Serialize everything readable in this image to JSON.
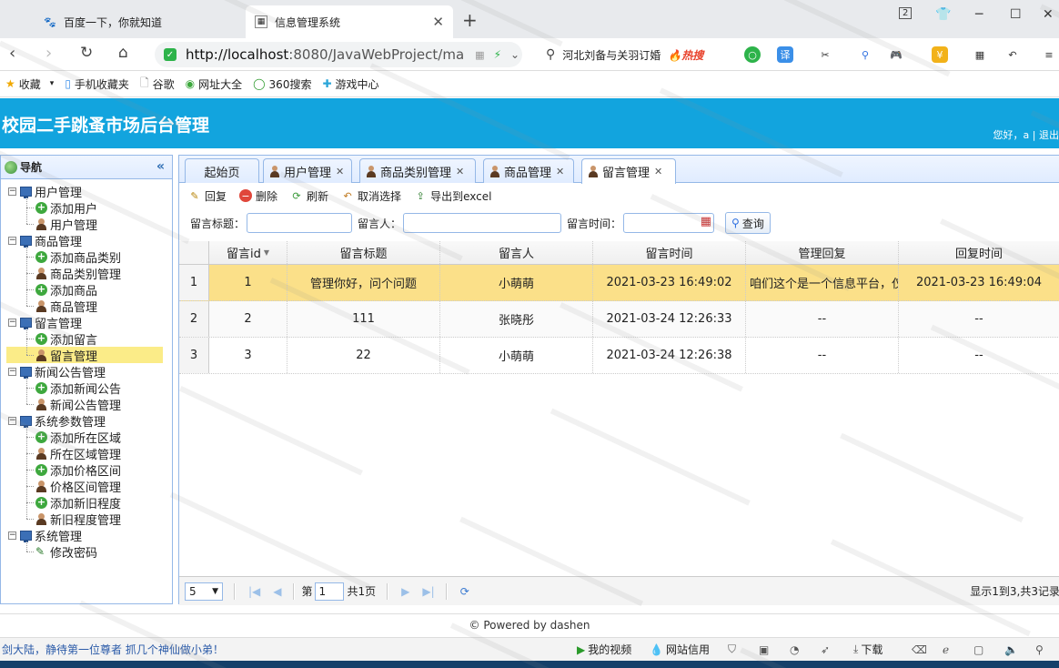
{
  "browser": {
    "tabs": [
      {
        "label": "百度一下，你就知道",
        "icon": "baidu-paw-icon"
      },
      {
        "label": "信息管理系统",
        "icon": "page-icon",
        "active": true
      }
    ],
    "url_host": "http://localhost",
    "url_rest": ":8080/JavaWebProject/ma",
    "search_text": "河北刘备与关羽订婚",
    "search_hot": "热搜",
    "tab_count": "2",
    "bookmarks": [
      "收藏",
      "手机收藏夹",
      "谷歌",
      "网址大全",
      "360搜索",
      "游戏中心"
    ],
    "translate_label": "译"
  },
  "app": {
    "title": "校园二手跳蚤市场后台管理",
    "user_greeting": "您好，a | 退出"
  },
  "nav": {
    "title": "导航",
    "collapse": "«",
    "groups": [
      {
        "label": "用户管理",
        "items": [
          "添加用户",
          "用户管理"
        ]
      },
      {
        "label": "商品管理",
        "items": [
          "添加商品类别",
          "商品类别管理",
          "添加商品",
          "商品管理"
        ]
      },
      {
        "label": "留言管理",
        "items": [
          "添加留言",
          "留言管理"
        ]
      },
      {
        "label": "新闻公告管理",
        "items": [
          "添加新闻公告",
          "新闻公告管理"
        ]
      },
      {
        "label": "系统参数管理",
        "items": [
          "添加所在区域",
          "所在区域管理",
          "添加价格区间",
          "价格区间管理",
          "添加新旧程度",
          "新旧程度管理"
        ]
      },
      {
        "label": "系统管理",
        "items": [
          "修改密码"
        ]
      }
    ]
  },
  "tabs": [
    "起始页",
    "用户管理",
    "商品类别管理",
    "商品管理",
    "留言管理"
  ],
  "toolbar": [
    "回复",
    "删除",
    "刷新",
    "取消选择",
    "导出到excel"
  ],
  "filter": {
    "title_label": "留言标题：",
    "person_label": "留言人：",
    "time_label": "留言时间：",
    "search_label": "查询"
  },
  "grid": {
    "columns": [
      "留言id",
      "留言标题",
      "留言人",
      "留言时间",
      "管理回复",
      "回复时间"
    ],
    "rows": [
      {
        "n": "1",
        "id": "1",
        "title": "管理你好，问个问题",
        "person": "小萌萌",
        "time": "2021-03-23 16:49:02",
        "reply": "咱们这个是一个信息平台，仅",
        "reply_time": "2021-03-23 16:49:04"
      },
      {
        "n": "2",
        "id": "2",
        "title": "111",
        "person": "张晓彤",
        "time": "2021-03-24 12:26:33",
        "reply": "--",
        "reply_time": "--"
      },
      {
        "n": "3",
        "id": "3",
        "title": "22",
        "person": "小萌萌",
        "time": "2021-03-24 12:26:38",
        "reply": "--",
        "reply_time": "--"
      }
    ]
  },
  "pager": {
    "page_size": "5",
    "page_prefix": "第",
    "page_num": "1",
    "page_total": "共1页",
    "info": "显示1到3,共3记录"
  },
  "footer": "© Powered by dashen",
  "statusbar": {
    "left_text": "剑大陆，静待第一位尊者 抓几个神仙做小弟！",
    "video": "我的视频",
    "credit": "网站信用",
    "download": "下载"
  }
}
